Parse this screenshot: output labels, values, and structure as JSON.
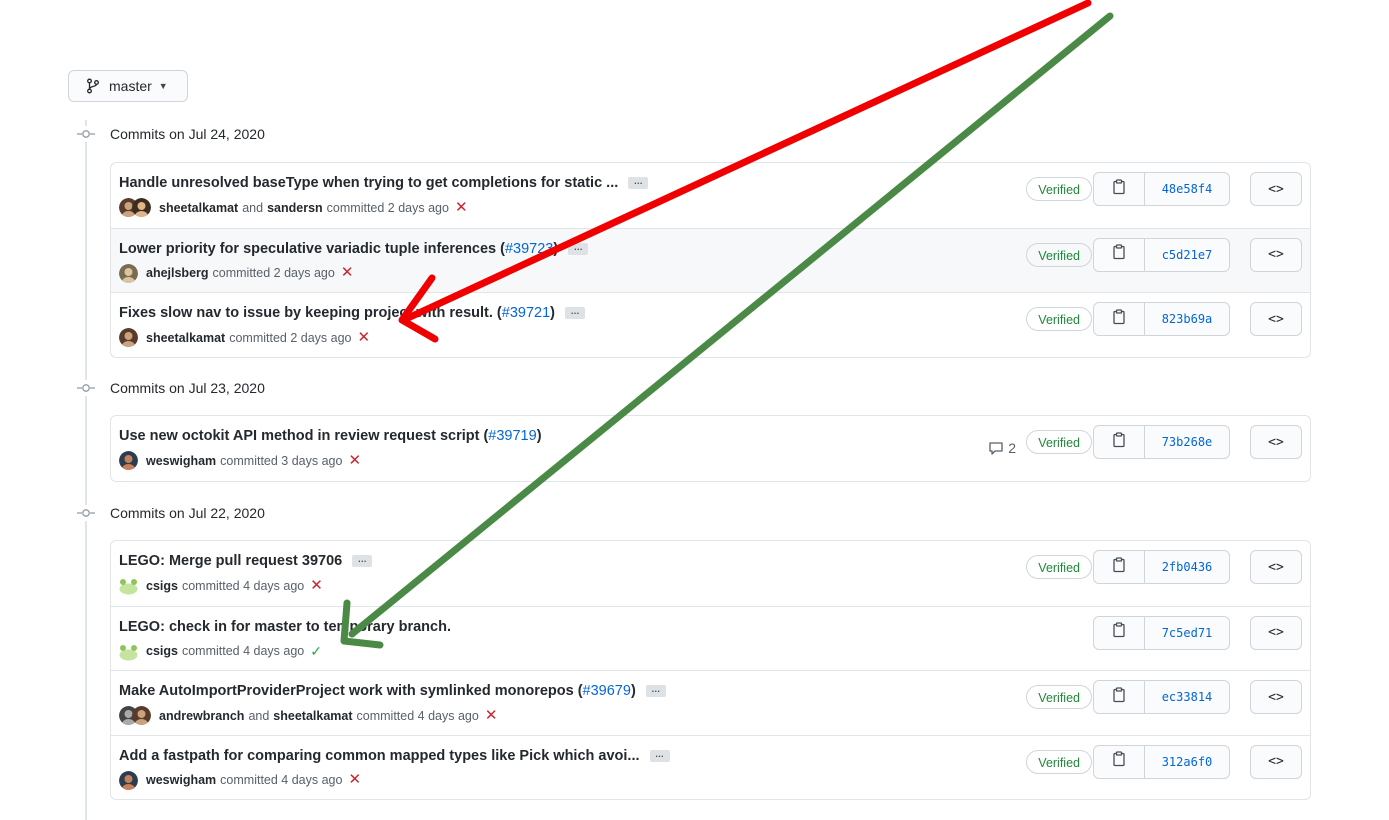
{
  "branch": {
    "name": "master"
  },
  "groups": [
    {
      "date_label": "Commits on Jul 24, 2020",
      "commits": [
        {
          "title": "Handle unresolved baseType when trying to get completions for static ...",
          "pr": "",
          "authors": [
            "sheetalkamat",
            "sandersn"
          ],
          "joiner": "and",
          "time": "committed 2 days ago",
          "status": "fail",
          "verified": "Verified",
          "sha": "48e58f4"
        },
        {
          "title": "Lower priority for speculative variadic tuple inferences (",
          "pr": "#39723",
          "pr_close": ")",
          "authors": [
            "ahejlsberg"
          ],
          "time": "committed 2 days ago",
          "status": "fail",
          "verified": "Verified",
          "sha": "c5d21e7"
        },
        {
          "title": "Fixes slow nav to issue by keeping project with result. (",
          "pr": "#39721",
          "pr_close": ")",
          "authors": [
            "sheetalkamat"
          ],
          "time": "committed 2 days ago",
          "status": "fail",
          "verified": "Verified",
          "sha": "823b69a"
        }
      ]
    },
    {
      "date_label": "Commits on Jul 23, 2020",
      "commits": [
        {
          "title": "Use new octokit API method in review request script (",
          "pr": "#39719",
          "pr_close": ")",
          "authors": [
            "weswigham"
          ],
          "time": "committed 3 days ago",
          "status": "fail",
          "comments": "2",
          "verified": "Verified",
          "sha": "73b268e"
        }
      ]
    },
    {
      "date_label": "Commits on Jul 22, 2020",
      "commits": [
        {
          "title": "LEGO: Merge pull request 39706",
          "pr": "",
          "authors": [
            "csigs"
          ],
          "time": "committed 4 days ago",
          "status": "fail",
          "verified": "Verified",
          "sha": "2fb0436"
        },
        {
          "title": "LEGO: check in for master to temporary branch.",
          "pr": "",
          "authors": [
            "csigs"
          ],
          "time": "committed 4 days ago",
          "status": "success",
          "verified": "",
          "sha": "7c5ed71"
        },
        {
          "title": "Make AutoImportProviderProject work with symlinked monorepos (",
          "pr": "#39679",
          "pr_close": ")",
          "authors": [
            "andrewbranch",
            "sheetalkamat"
          ],
          "joiner": "and",
          "time": "committed 4 days ago",
          "status": "fail",
          "verified": "Verified",
          "sha": "ec33814"
        },
        {
          "title": "Add a fastpath for comparing common mapped types like Pick which avoi...",
          "pr": "",
          "authors": [
            "weswigham"
          ],
          "time": "committed 4 days ago",
          "status": "fail",
          "verified": "Verified",
          "sha": "312a6f0"
        }
      ]
    }
  ],
  "labels": {
    "ellipsis": "…",
    "browse": "<>"
  },
  "annotation_colors": {
    "red_arrow": "#f00000",
    "green_arrow": "#4a8a46"
  }
}
